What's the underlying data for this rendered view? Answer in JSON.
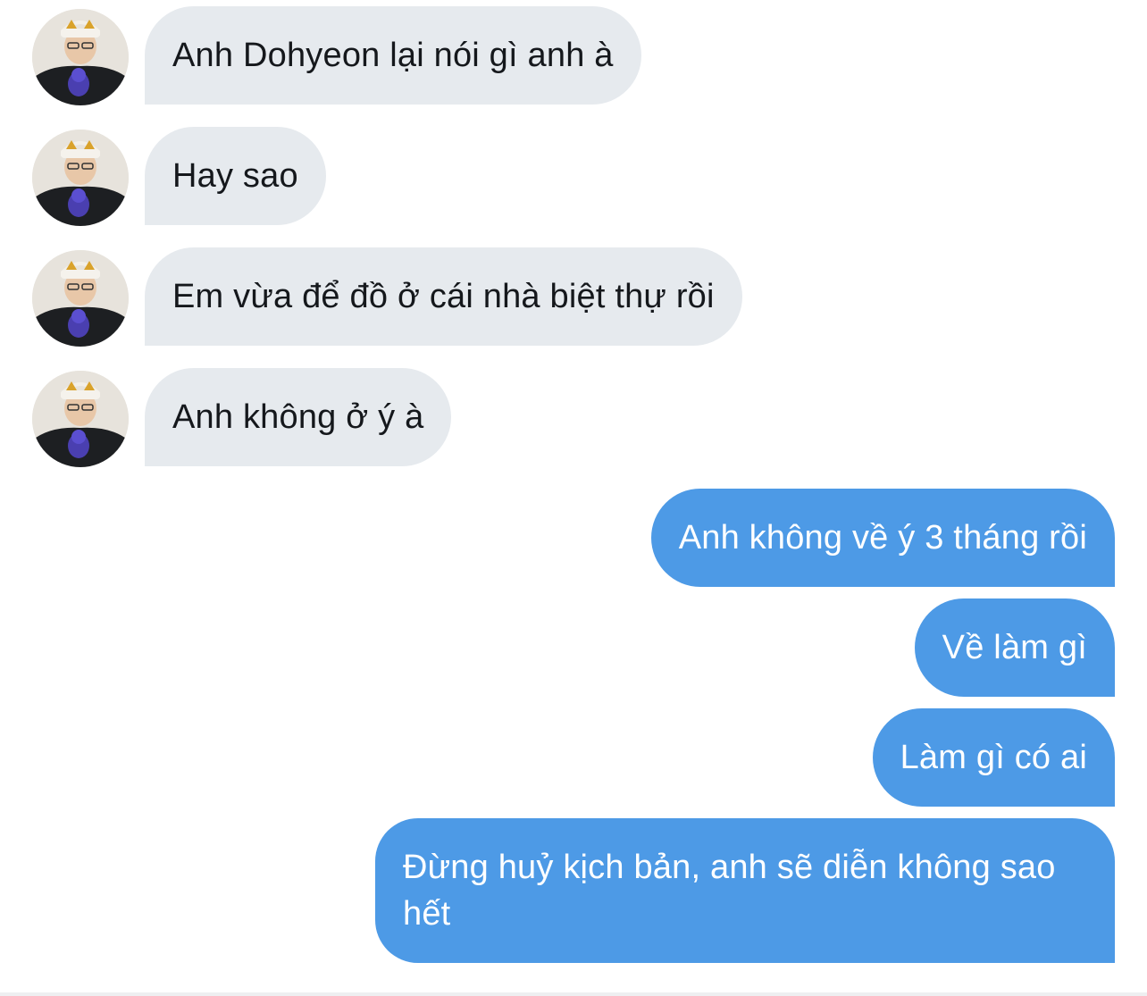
{
  "conversation": {
    "incoming": [
      {
        "text": "Anh Dohyeon lại nói gì anh à"
      },
      {
        "text": "Hay sao"
      },
      {
        "text": "Em vừa để đồ ở cái nhà biệt thự rồi"
      },
      {
        "text": "Anh không ở ý à"
      }
    ],
    "outgoing": [
      {
        "text": "Anh không về ý 3 tháng rồi"
      },
      {
        "text": "Về làm gì"
      },
      {
        "text": "Làm gì có ai"
      },
      {
        "text": "Đừng huỷ kịch bản, anh sẽ diễn không sao hết"
      }
    ]
  },
  "colors": {
    "incoming_bubble": "#e6eaee",
    "incoming_text": "#15181c",
    "outgoing_bubble": "#4d9ae6",
    "outgoing_text": "#ffffff"
  },
  "icons": {
    "avatar": "profile-photo-avatar"
  }
}
